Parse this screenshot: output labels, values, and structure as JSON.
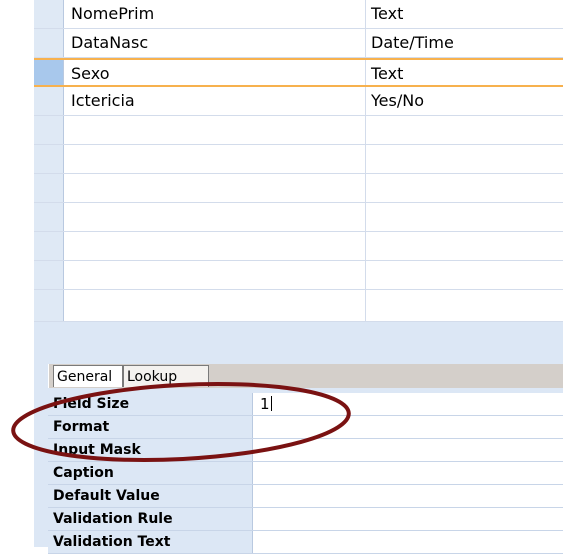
{
  "fields": [
    {
      "name": "NomePrim",
      "type": "Text"
    },
    {
      "name": "DataNasc",
      "type": "Date/Time"
    },
    {
      "name": "Sexo",
      "type": "Text"
    },
    {
      "name": "Ictericia",
      "type": "Yes/No"
    },
    {
      "name": "",
      "type": ""
    },
    {
      "name": "",
      "type": ""
    },
    {
      "name": "",
      "type": ""
    },
    {
      "name": "",
      "type": ""
    },
    {
      "name": "",
      "type": ""
    },
    {
      "name": "",
      "type": ""
    },
    {
      "name": "",
      "type": ""
    }
  ],
  "selected_row": 2,
  "tabs": {
    "general": "General",
    "lookup": "Lookup"
  },
  "properties": [
    {
      "label": "Field Size",
      "value": "1"
    },
    {
      "label": "Format",
      "value": ""
    },
    {
      "label": "Input Mask",
      "value": ""
    },
    {
      "label": "Caption",
      "value": ""
    },
    {
      "label": "Default Value",
      "value": ""
    },
    {
      "label": "Validation Rule",
      "value": ""
    },
    {
      "label": "Validation Text",
      "value": ""
    }
  ],
  "colors": {
    "selected_border": "#f7b14e",
    "annotation": "#7a1212"
  }
}
